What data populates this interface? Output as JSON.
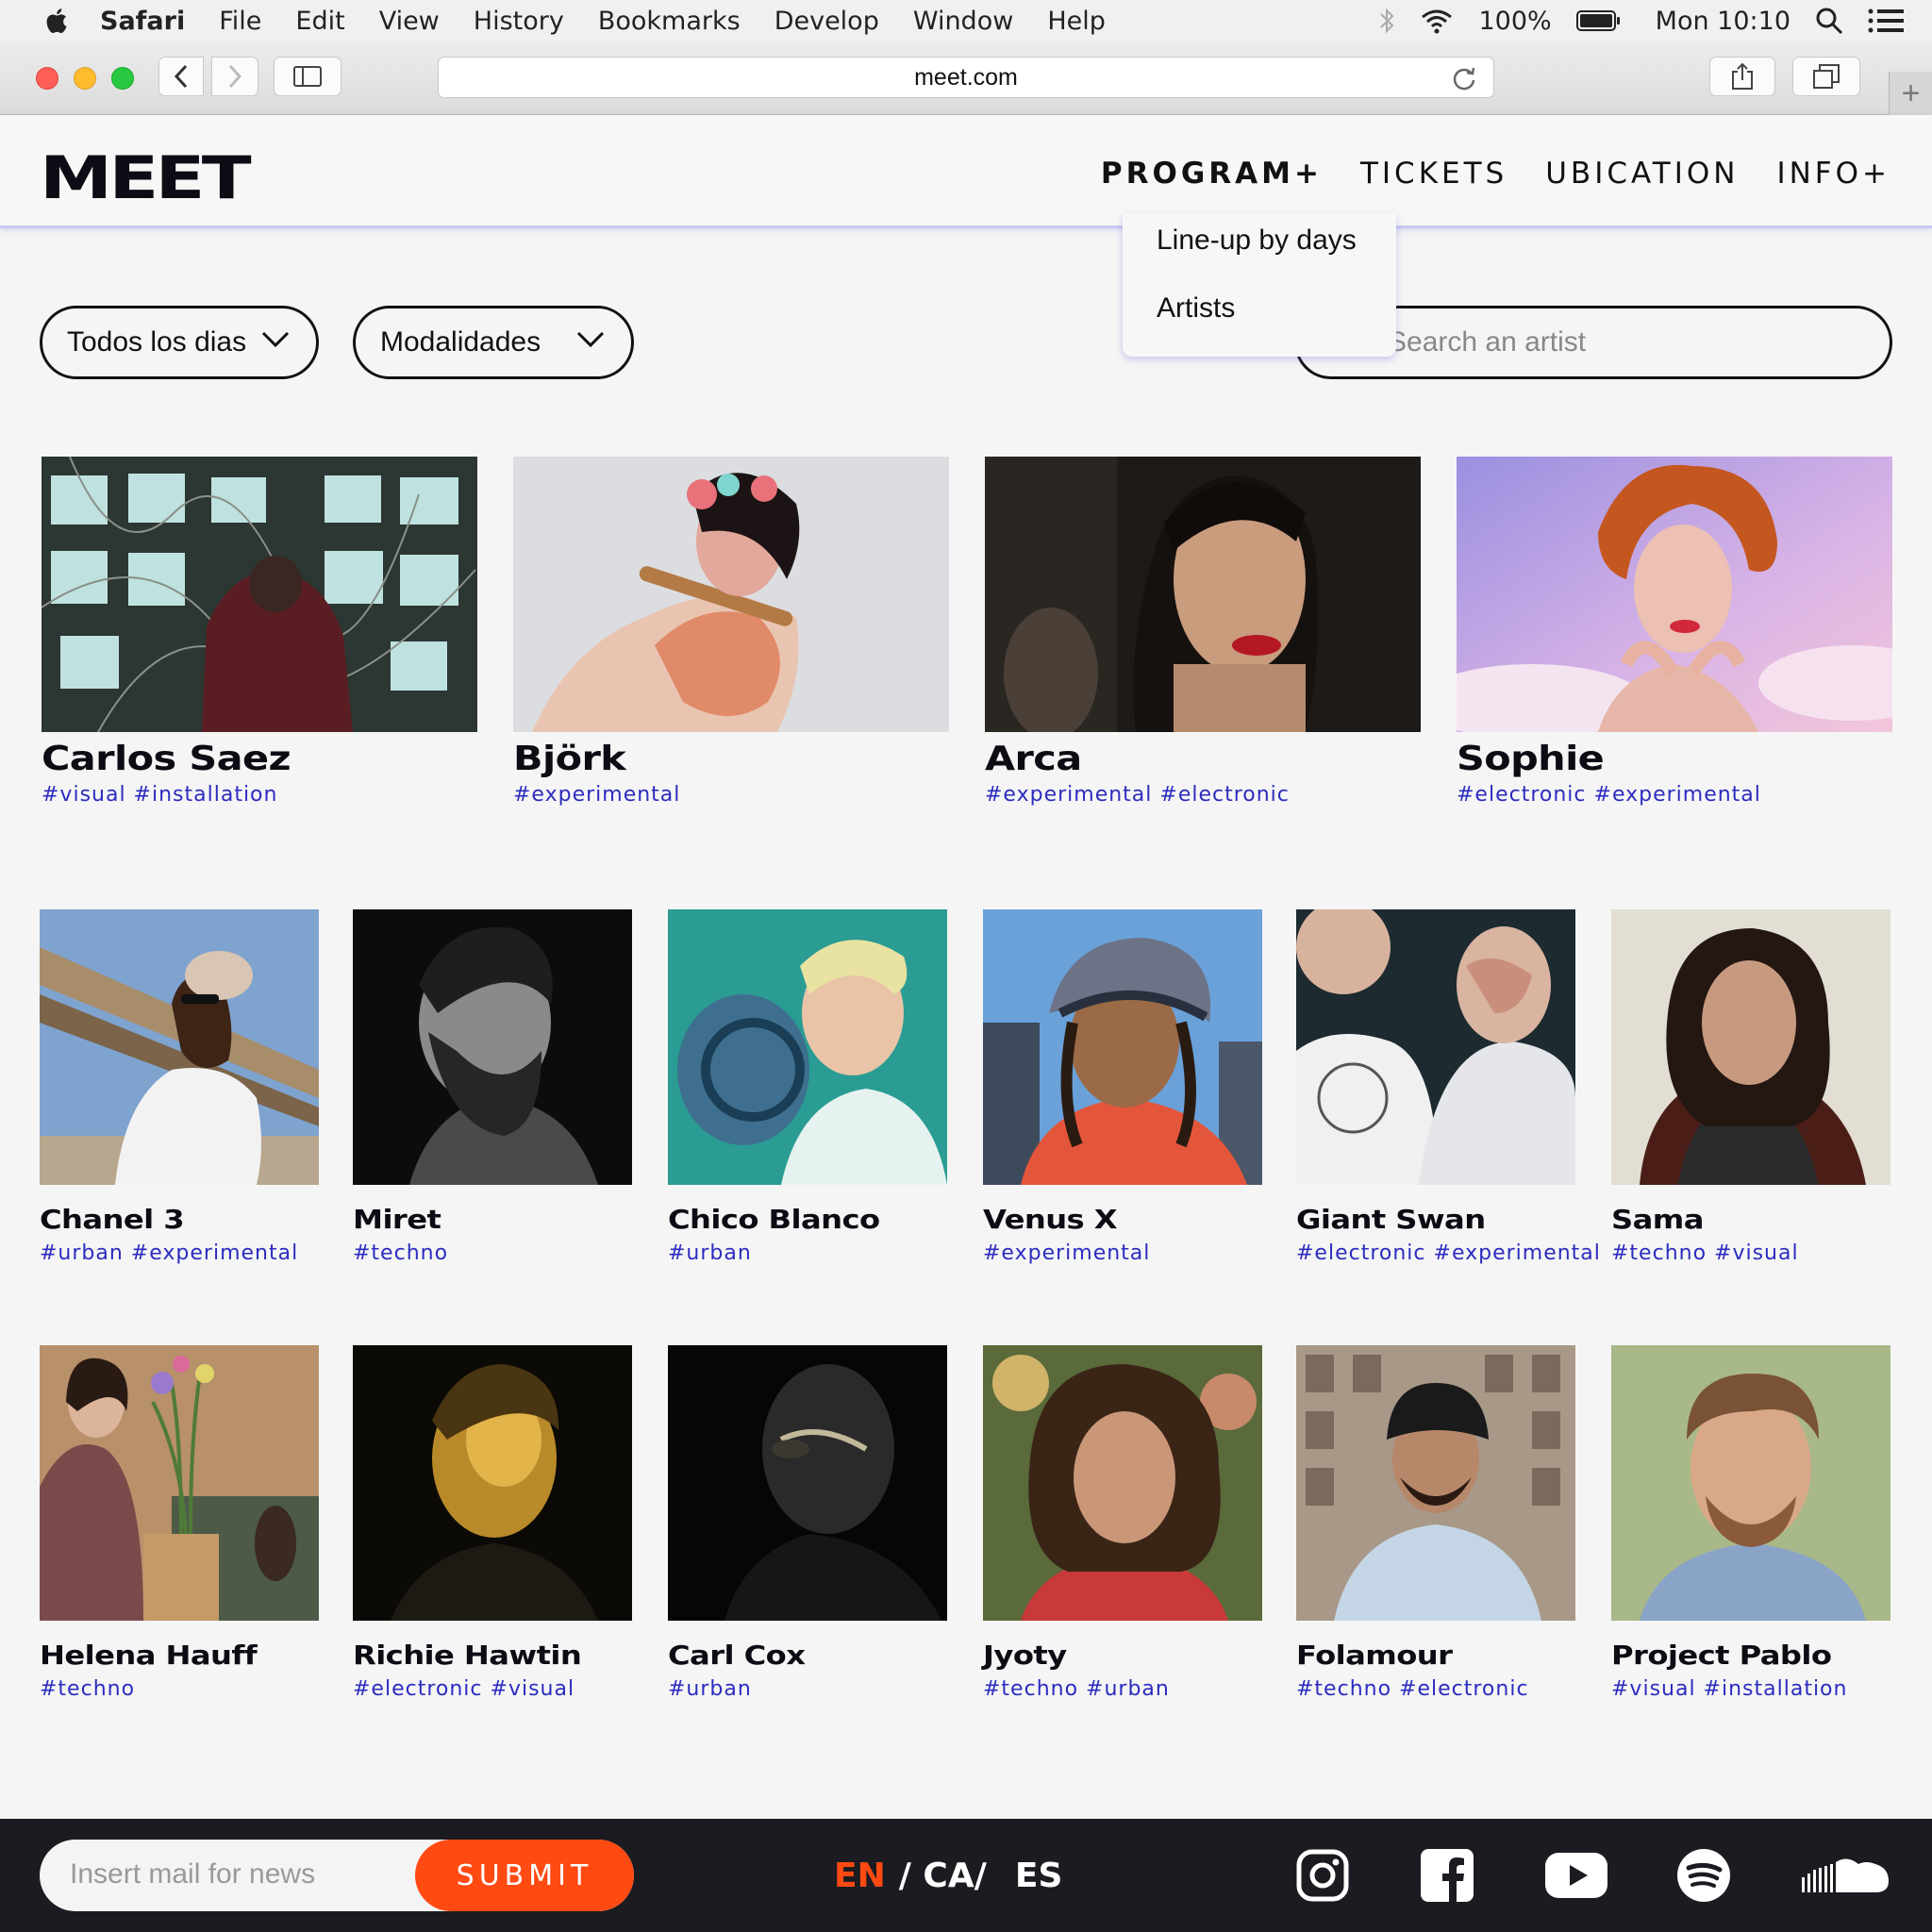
{
  "menubar": {
    "app": "Safari",
    "items": [
      "File",
      "Edit",
      "View",
      "History",
      "Bookmarks",
      "Develop",
      "Window",
      "Help"
    ],
    "battery": "100%",
    "clock": "Mon 10:10"
  },
  "browser": {
    "url": "meet.com"
  },
  "site": {
    "logo": "MEET",
    "nav": [
      "PROGRAM+",
      "TICKETS",
      "UBICATION",
      "INFO+"
    ],
    "dropdown": [
      "Line-up by days",
      "Artists"
    ],
    "filters": {
      "days": "Todos los dias",
      "modes": "Modalidades",
      "search_placeholder": "Search an artist"
    }
  },
  "artists_featured": [
    {
      "name": "Carlos Saez",
      "tags": "#visual #installation"
    },
    {
      "name": "Björk",
      "tags": "#experimental"
    },
    {
      "name": "Arca",
      "tags": "#experimental #electronic"
    },
    {
      "name": "Sophie",
      "tags": "#electronic #experimental"
    }
  ],
  "artists": [
    {
      "name": "Chanel 3",
      "tags": "#urban #experimental"
    },
    {
      "name": "Miret",
      "tags": "#techno"
    },
    {
      "name": "Chico Blanco",
      "tags": "#urban"
    },
    {
      "name": "Venus X",
      "tags": "#experimental"
    },
    {
      "name": "Giant Swan",
      "tags": "#electronic #experimental"
    },
    {
      "name": "Sama",
      "tags": "#techno #visual"
    },
    {
      "name": "Helena Hauff",
      "tags": "#techno"
    },
    {
      "name": "Richie Hawtin",
      "tags": "#electronic #visual"
    },
    {
      "name": "Carl Cox",
      "tags": "#urban"
    },
    {
      "name": "Jyoty",
      "tags": "#techno #urban"
    },
    {
      "name": "Folamour",
      "tags": "#techno #electronic"
    },
    {
      "name": "Project Pablo",
      "tags": "#visual #installation"
    }
  ],
  "footer": {
    "news_placeholder": "Insert mail for news",
    "submit": "SUBMIT",
    "lang_en": "EN",
    "lang_ca": "/ CA/",
    "lang_es": "ES",
    "social_icons": [
      "instagram-icon",
      "facebook-icon",
      "youtube-icon",
      "spotify-icon",
      "soundcloud-icon"
    ]
  },
  "colors": {
    "accent": "#ff4a12",
    "tag": "#2c2cc0",
    "dark": "#1b1b21"
  }
}
